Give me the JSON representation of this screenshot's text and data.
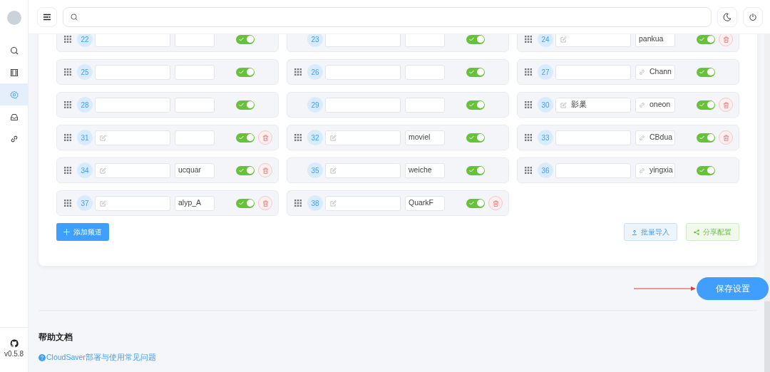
{
  "sidebar": {
    "items": [
      {
        "kind": "search",
        "selected": false
      },
      {
        "kind": "film",
        "selected": false
      },
      {
        "kind": "gear",
        "selected": true
      },
      {
        "kind": "inbox",
        "selected": false
      },
      {
        "kind": "link",
        "selected": false
      }
    ],
    "version": "v0.5.8"
  },
  "channels": [
    {
      "number": "22",
      "handle": true,
      "edit_icon": false,
      "link_icon": false,
      "on": true,
      "delete_button": false
    },
    {
      "number": "23",
      "handle": false,
      "edit_icon": false,
      "link_icon": false,
      "on": true,
      "delete_button": false
    },
    {
      "number": "24",
      "handle": true,
      "edit_icon": true,
      "link": "pankua",
      "link_icon": false,
      "on": true,
      "delete_button": true
    },
    {
      "number": "25",
      "handle": true,
      "edit_icon": false,
      "link_icon": false,
      "on": true,
      "delete_button": false
    },
    {
      "number": "26",
      "handle": true,
      "edit_icon": false,
      "link_icon": false,
      "on": true,
      "delete_button": false
    },
    {
      "number": "27",
      "handle": true,
      "edit_icon": false,
      "link": "Chann",
      "link_icon": true,
      "on": true,
      "delete_button": false
    },
    {
      "number": "28",
      "handle": true,
      "edit_icon": false,
      "link_icon": false,
      "on": true,
      "delete_button": false
    },
    {
      "number": "29",
      "handle": false,
      "edit_icon": false,
      "link_icon": false,
      "on": true,
      "delete_button": false
    },
    {
      "number": "30",
      "handle": true,
      "edit_icon": true,
      "name": "影巢",
      "link": "oneon",
      "link_icon": true,
      "on": true,
      "delete_button": true
    },
    {
      "number": "31",
      "handle": true,
      "edit_icon": true,
      "link_icon": false,
      "on": true,
      "delete_button": true
    },
    {
      "number": "32",
      "handle": true,
      "edit_icon": true,
      "link": "moviel",
      "link_icon": false,
      "on": true,
      "delete_button": false
    },
    {
      "number": "33",
      "handle": true,
      "edit_icon": false,
      "link": "CBdua",
      "link_icon": true,
      "on": true,
      "delete_button": true
    },
    {
      "number": "34",
      "handle": true,
      "edit_icon": true,
      "link": "ucquar",
      "link_icon": false,
      "on": true,
      "delete_button": true
    },
    {
      "number": "35",
      "handle": false,
      "edit_icon": true,
      "link": "weiche",
      "link_icon": false,
      "on": true,
      "delete_button": false
    },
    {
      "number": "36",
      "handle": true,
      "edit_icon": false,
      "link": "yingxia",
      "link_icon": true,
      "on": true,
      "delete_button": false
    },
    {
      "number": "37",
      "handle": true,
      "edit_icon": true,
      "link": "alyp_A",
      "link_icon": false,
      "on": true,
      "delete_button": true
    },
    {
      "number": "38",
      "handle": true,
      "edit_icon": true,
      "link": "QuarkF",
      "link_icon": false,
      "on": true,
      "delete_button": true
    }
  ],
  "add_button": "添加频道",
  "import_button": "批量导入",
  "share_button": "分享配置",
  "save_button": "保存设置",
  "help": {
    "title": "帮助文档",
    "links": [
      "CloudSaver部署与使用常见问题"
    ]
  }
}
